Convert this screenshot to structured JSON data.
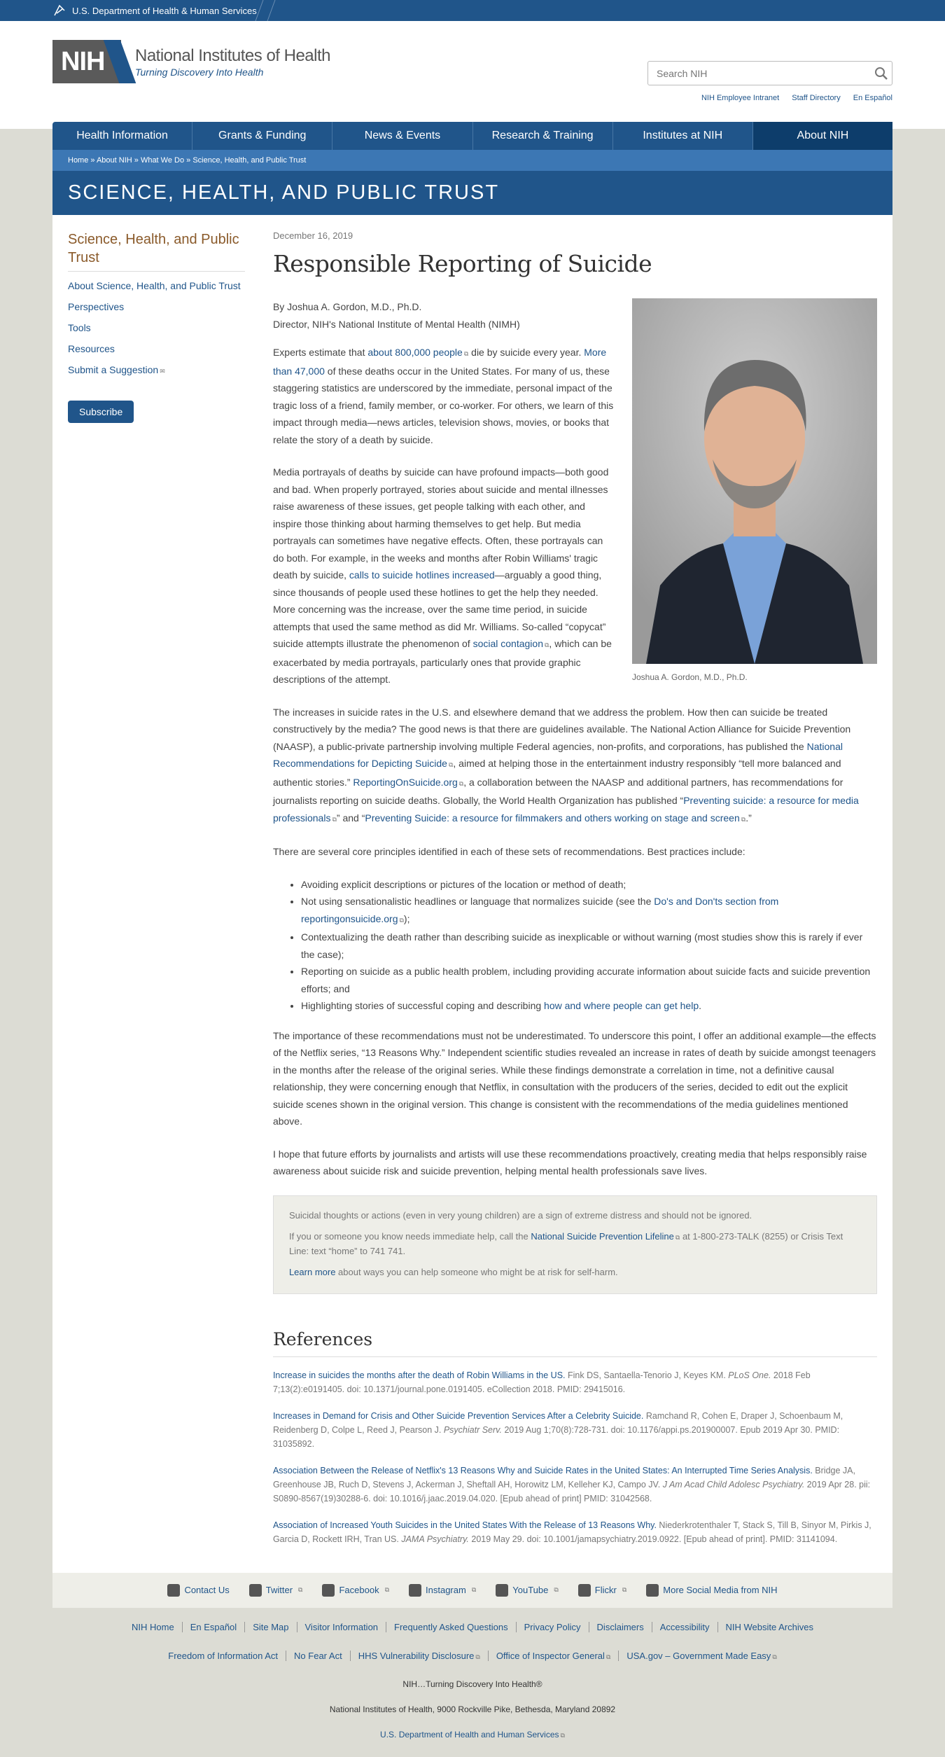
{
  "hhs": {
    "label": "U.S. Department of Health & Human Services"
  },
  "logo": {
    "mark": "NIH",
    "title": "National Institutes of Health",
    "tagline": "Turning Discovery Into Health"
  },
  "search": {
    "placeholder": "Search NIH"
  },
  "util_links": [
    "NIH Employee Intranet",
    "Staff Directory",
    "En Español"
  ],
  "nav": [
    "Health Information",
    "Grants & Funding",
    "News & Events",
    "Research & Training",
    "Institutes at NIH",
    "About NIH"
  ],
  "breadcrumb": "Home » About NIH » What We Do » Science, Health, and Public Trust",
  "banner": "SCIENCE, HEALTH, AND PUBLIC TRUST",
  "sidebar": {
    "title": "Science, Health, and Public Trust",
    "links": [
      "About Science, Health, and Public Trust",
      "Perspectives",
      "Tools",
      "Resources",
      "Submit a Suggestion"
    ],
    "subscribe": "Subscribe"
  },
  "article": {
    "date": "December 16, 2019",
    "title": "Responsible Reporting of Suicide",
    "author": "By Joshua A. Gordon, M.D., Ph.D.",
    "role": "Director, NIH's National Institute of Mental Health (NIMH)",
    "photo_caption": "Joshua A. Gordon, M.D., Ph.D.",
    "p1": {
      "a": "Experts estimate that ",
      "link1": "about 800,000 people",
      "b": " die by suicide every year. ",
      "link2": "More than 47,000",
      "c": " of these deaths occur in the United States. For many of us, these staggering statistics are underscored by the immediate, personal impact of the tragic loss of a friend, family member, or co-worker. For others, we learn of this impact through media—news articles, television shows, movies, or books that relate the story of a death by suicide."
    },
    "p2": {
      "a": "Media portrayals of deaths by suicide can have profound impacts—both good and bad. When properly portrayed, stories about suicide and mental illnesses raise awareness of these issues, get people talking with each other, and inspire those thinking about harming themselves to get help. But media portrayals can sometimes have negative effects. Often, these portrayals can do both. For example, in the weeks and months after Robin Williams' tragic death by suicide, ",
      "link1": "calls to suicide hotlines increased",
      "b": "—arguably a good thing, since thousands of people used these hotlines to get the help they needed. More concerning was the increase, over the same time period, in suicide attempts that used the same method as did Mr. Williams. So-called “copycat” suicide attempts illustrate the phenomenon of ",
      "link2": "social contagion",
      "c": ", which can be exacerbated by media portrayals, particularly ones that provide graphic descriptions of the attempt."
    },
    "p3": {
      "a": "The increases in suicide rates in the U.S. and elsewhere demand that we address the problem. How then can suicide be treated constructively by the media? The good news is that there are guidelines available. The National Action Alliance for Suicide Prevention (NAASP), a public-private partnership involving multiple Federal agencies, non-profits, and corporations, has published the ",
      "link1": "National Recommendations for Depicting Suicide",
      "b": ", aimed at helping those in the entertainment industry responsibly “tell more balanced and authentic stories.” ",
      "link2": "ReportingOnSuicide.org",
      "c": ", a collaboration between the NAASP and additional partners, has recommendations for journalists reporting on suicide deaths.  Globally, the World Health Organization has published “",
      "link3": "Preventing suicide: a resource for media professionals",
      "d": "” and “",
      "link4": "Preventing Suicide:  a resource for filmmakers and others working on stage and screen",
      "e": ".”"
    },
    "p4": "There are several core principles identified in each of these sets of recommendations. Best practices include:",
    "bullets": {
      "b1": "Avoiding explicit descriptions or pictures of the location or method of death;",
      "b2a": "Not using sensationalistic headlines or language that normalizes suicide (see the ",
      "b2link": "Do's and Don'ts section from reportingonsuicide.org",
      "b2b": ");",
      "b3": "Contextualizing the death rather than describing suicide as inexplicable or without warning (most studies show this is rarely if ever the case);",
      "b4": "Reporting on suicide as a public health problem, including providing accurate information about suicide facts and suicide prevention efforts; and",
      "b5a": "Highlighting stories of successful coping and describing ",
      "b5link": "how and where people can get help",
      "b5b": "."
    },
    "p5": "The importance of these recommendations must not be underestimated. To underscore this point, I offer an additional example—the effects of the Netflix series, “13 Reasons Why.” Independent scientific studies revealed an increase in rates of death by suicide amongst teenagers in the months after the release of the original series. While these findings demonstrate a correlation in time, not a definitive causal relationship, they were concerning enough that Netflix, in consultation with the producers of the series, decided to edit out the explicit suicide scenes shown in the original version. This change is consistent with the recommendations of the media guidelines mentioned above.",
    "p6": "I hope that future efforts by journalists and artists will use these recommendations proactively, creating media that helps responsibly raise awareness about suicide risk and suicide prevention, helping mental health professionals save lives."
  },
  "callout": {
    "l1": "Suicidal thoughts or actions (even in very young children) are a sign of extreme distress and should not be ignored.",
    "l2a": "If you or someone you know needs immediate help, call the ",
    "l2link": "National Suicide Prevention Lifeline",
    "l2b": " at 1-800-273-TALK (8255) or Crisis Text Line: text “home” to 741 741.",
    "l3link": "Learn more",
    "l3b": " about ways you can help someone who might be at risk for self-harm."
  },
  "references": {
    "heading": "References",
    "r1": {
      "link": "Increase in suicides the months after the death of Robin Williams in the US.",
      "a": " Fink DS, Santaella-Tenorio J, Keyes KM. ",
      "journal": "PLoS One.",
      "b": " 2018 Feb 7;13(2):e0191405. doi: 10.1371/journal.pone.0191405. eCollection 2018. PMID: 29415016."
    },
    "r2": {
      "link": "Increases in Demand for Crisis and Other Suicide Prevention Services After a Celebrity Suicide.",
      "a": " Ramchand R, Cohen E, Draper J, Schoenbaum M, Reidenberg D, Colpe L, Reed J, Pearson J. ",
      "journal": "Psychiatr Serv.",
      "b": " 2019 Aug 1;70(8):728-731. doi: 10.1176/appi.ps.201900007. Epub 2019 Apr 30. PMID: 31035892."
    },
    "r3": {
      "link": "Association Between the Release of Netflix's 13 Reasons Why and Suicide Rates in the United States: An Interrupted Time Series Analysis.",
      "a": " Bridge JA, Greenhouse JB, Ruch D, Stevens J, Ackerman J, Sheftall AH, Horowitz LM, Kelleher KJ, Campo JV. ",
      "journal": "J Am Acad Child Adolesc Psychiatry.",
      "b": " 2019 Apr 28. pii: S0890-8567(19)30288-6. doi: 10.1016/j.jaac.2019.04.020. [Epub ahead of print] PMID: 31042568."
    },
    "r4": {
      "link": "Association of Increased Youth Suicides in the United States With the Release of 13 Reasons Why.",
      "a": " Niederkrotenthaler T, Stack S, Till B, Sinyor M, Pirkis J, Garcia D, Rockett IRH, Tran US. ",
      "journal": "JAMA Psychiatry.",
      "b": " 2019 May 29. doi: 10.1001/jamapsychiatry.2019.0922. [Epub ahead of print]. PMID: 31141094."
    }
  },
  "social": [
    "Contact Us",
    "Twitter",
    "Facebook",
    "Instagram",
    "YouTube",
    "Flickr",
    "More Social Media from NIH"
  ],
  "footer": {
    "row1": [
      "NIH Home",
      "En Español",
      "Site Map",
      "Visitor Information",
      "Frequently Asked Questions",
      "Privacy Policy",
      "Disclaimers",
      "Accessibility",
      "NIH Website Archives"
    ],
    "row2": [
      "Freedom of Information Act",
      "No Fear Act",
      "HHS Vulnerability Disclosure",
      "Office of Inspector General",
      "USA.gov – Government Made Easy"
    ],
    "tagline": "NIH…Turning Discovery Into Health®",
    "address": "National Institutes of Health, 9000 Rockville Pike, Bethesda, Maryland 20892",
    "hhs_link": "U.S. Department of Health and Human Services"
  }
}
